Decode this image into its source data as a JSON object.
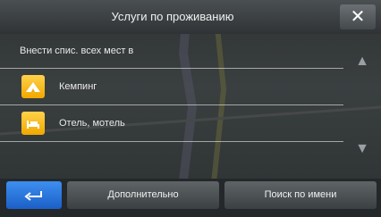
{
  "header": {
    "title": "Услуги по проживанию"
  },
  "list": {
    "header_label": "Внести спис. всех мест в",
    "items": [
      {
        "label": "Кемпинг",
        "icon": "camping-icon"
      },
      {
        "label": "Отель, мотель",
        "icon": "hotel-icon"
      }
    ]
  },
  "buttons": {
    "close": "✕",
    "back_icon": "back-arrow-icon",
    "more": "Дополнительно",
    "search_by_name": "Поиск по имени"
  },
  "colors": {
    "icon_yellow": "#f0a800",
    "back_button_blue": "#1b5fc7"
  }
}
